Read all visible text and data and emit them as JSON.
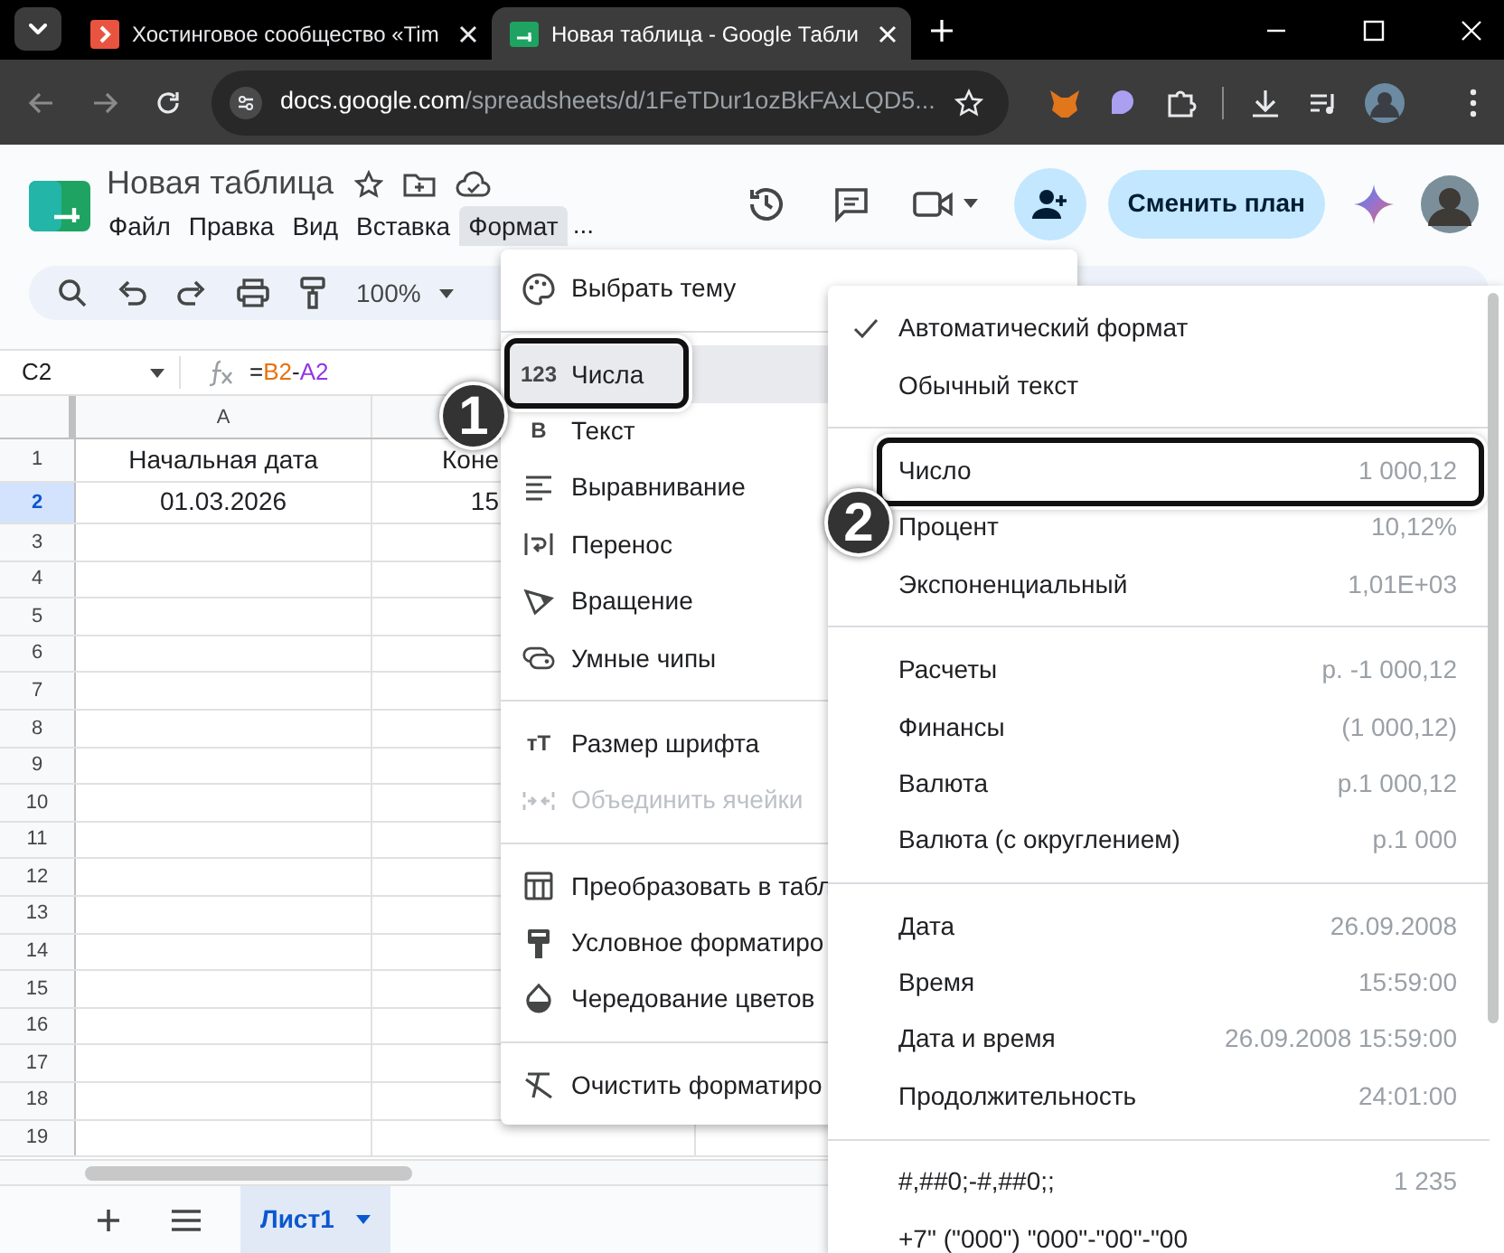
{
  "browser": {
    "tabs": [
      {
        "title": "Хостинговое сообщество «Tim",
        "selected": false
      },
      {
        "title": "Новая таблица - Google Табли",
        "selected": true
      }
    ],
    "address": {
      "domain": "docs.google.com",
      "path": "/spreadsheets/d/1FeTDur1ozBkFAxLQD5..."
    }
  },
  "document": {
    "title": "Новая таблица",
    "menu": [
      {
        "label": "Файл",
        "selected": false
      },
      {
        "label": "Правка",
        "selected": false
      },
      {
        "label": "Вид",
        "selected": false
      },
      {
        "label": "Вставка",
        "selected": false
      },
      {
        "label": "Формат",
        "selected": true
      }
    ],
    "more": "...",
    "plan_button": "Сменить план"
  },
  "toolbar": {
    "zoom": "100%"
  },
  "formula_bar": {
    "cell": "C2",
    "parts": [
      {
        "text": "="
      },
      {
        "text": "B2",
        "color": "#e8710a"
      },
      {
        "text": "-"
      },
      {
        "text": "A2",
        "color": "#9334e6"
      }
    ]
  },
  "grid": {
    "columns": [
      {
        "label": "A"
      }
    ],
    "rows": [
      {
        "label": "1",
        "selected": false,
        "cells": [
          "Начальная дата",
          "Коне"
        ]
      },
      {
        "label": "2",
        "selected": true,
        "cells": [
          "01.03.2026",
          "15"
        ]
      },
      {
        "label": "3",
        "selected": false
      },
      {
        "label": "4",
        "selected": false
      },
      {
        "label": "5",
        "selected": false
      },
      {
        "label": "6",
        "selected": false
      },
      {
        "label": "7",
        "selected": false
      },
      {
        "label": "8",
        "selected": false
      },
      {
        "label": "9",
        "selected": false
      },
      {
        "label": "10",
        "selected": false
      },
      {
        "label": "11",
        "selected": false
      },
      {
        "label": "12",
        "selected": false
      },
      {
        "label": "13",
        "selected": false
      },
      {
        "label": "14",
        "selected": false
      },
      {
        "label": "15",
        "selected": false
      },
      {
        "label": "16",
        "selected": false
      },
      {
        "label": "17",
        "selected": false
      },
      {
        "label": "18",
        "selected": false
      },
      {
        "label": "19",
        "selected": false
      }
    ]
  },
  "sheets": [
    {
      "label": "Лист1",
      "selected": true
    }
  ],
  "format_menu": {
    "sections": [
      [
        {
          "label": "Выбрать тему",
          "selected": false,
          "disabled": false,
          "marked": false
        }
      ],
      [
        {
          "label": "Числа",
          "glyph": "123",
          "selected": true,
          "disabled": false,
          "marked": true
        },
        {
          "label": "Текст",
          "glyph": "B",
          "selected": false,
          "disabled": false,
          "marked": false
        },
        {
          "label": "Выравнивание",
          "selected": false,
          "disabled": false,
          "marked": false
        },
        {
          "label": "Перенос",
          "selected": false,
          "disabled": false,
          "marked": false
        },
        {
          "label": "Вращение",
          "selected": false,
          "disabled": false,
          "marked": false
        },
        {
          "label": "Умные чипы",
          "selected": false,
          "disabled": false,
          "marked": false
        }
      ],
      [
        {
          "label": "Размер шрифта",
          "glyph": "тT",
          "selected": false,
          "disabled": false,
          "marked": false
        },
        {
          "label": "Объединить ячейки",
          "selected": false,
          "disabled": true,
          "marked": false
        }
      ],
      [
        {
          "label": "Преобразовать в табл",
          "selected": false,
          "disabled": false,
          "marked": false
        },
        {
          "label": "Условное форматиро",
          "selected": false,
          "disabled": false,
          "marked": false
        },
        {
          "label": "Чередование цветов",
          "selected": false,
          "disabled": false,
          "marked": false
        }
      ],
      [
        {
          "label": "Очистить форматиро",
          "selected": false,
          "disabled": false,
          "marked": false
        }
      ]
    ]
  },
  "number_menu": {
    "sections": [
      [
        {
          "label": "Автоматический формат",
          "checked": true,
          "marked": false
        },
        {
          "label": "Обычный текст",
          "checked": false,
          "marked": false
        }
      ],
      [
        {
          "label": "Число",
          "example": "1 000,12",
          "checked": false,
          "marked": true
        },
        {
          "label": "Процент",
          "example": "10,12%",
          "checked": false,
          "marked": false
        },
        {
          "label": "Экспоненциальный",
          "example": "1,01E+03",
          "checked": false,
          "marked": false
        }
      ],
      [
        {
          "label": "Расчеты",
          "example": "р. -1 000,12",
          "checked": false,
          "marked": false
        },
        {
          "label": "Финансы",
          "example": "(1 000,12)",
          "checked": false,
          "marked": false
        },
        {
          "label": "Валюта",
          "example": "р.1 000,12",
          "checked": false,
          "marked": false
        },
        {
          "label": "Валюта (с округлением)",
          "example": "р.1 000",
          "checked": false,
          "marked": false
        }
      ],
      [
        {
          "label": "Дата",
          "example": "26.09.2008",
          "checked": false,
          "marked": false
        },
        {
          "label": "Время",
          "example": "15:59:00",
          "checked": false,
          "marked": false
        },
        {
          "label": "Дата и время",
          "example": "26.09.2008 15:59:00",
          "checked": false,
          "marked": false
        },
        {
          "label": "Продолжительность",
          "example": "24:01:00",
          "checked": false,
          "marked": false
        }
      ],
      [
        {
          "label": "#,##0;-#,##0;;",
          "example": "1 235",
          "checked": false,
          "marked": false
        },
        {
          "label": "+7\" (\"000\") \"000\"-\"00\"-\"00",
          "checked": false,
          "marked": false
        }
      ]
    ]
  },
  "annotations": [
    {
      "label": "1"
    },
    {
      "label": "2"
    }
  ]
}
